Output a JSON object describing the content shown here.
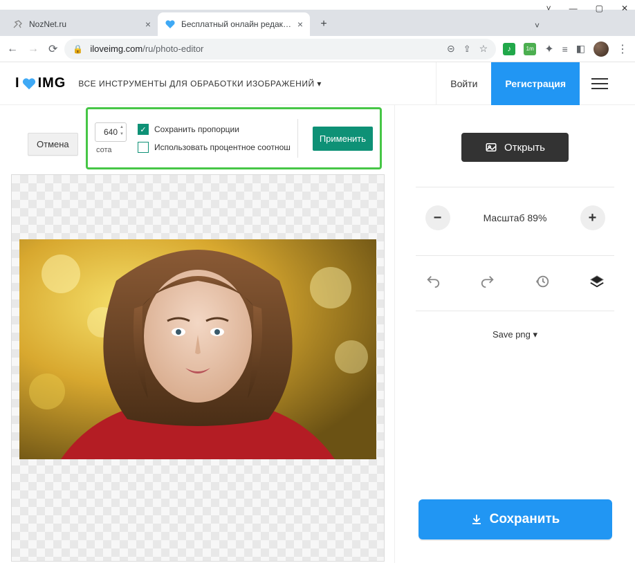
{
  "browser": {
    "tabs": [
      {
        "title": "NozNet.ru"
      },
      {
        "title": "Бесплатный онлайн редактор ф"
      }
    ],
    "url_host": "iloveimg.com",
    "url_path": "/ru/photo-editor"
  },
  "header": {
    "logo_left": "I",
    "logo_right": "IMG",
    "tools_label": "ВСЕ ИНСТРУМЕНТЫ ДЛЯ ОБРАБОТКИ ИЗОБРАЖЕНИЙ ▾",
    "login": "Войти",
    "register": "Регистрация"
  },
  "resize_popup": {
    "width_value": "640",
    "height_label": "сота",
    "keep_aspect": "Сохранить пропорции",
    "use_percent": "Использовать процентное соотнош",
    "apply": "Применить"
  },
  "cancel": "Отмена",
  "sidebar": {
    "open": "Открыть",
    "zoom_label": "Масштаб  89%",
    "save_png": "Save png ▾",
    "save": "Сохранить"
  }
}
